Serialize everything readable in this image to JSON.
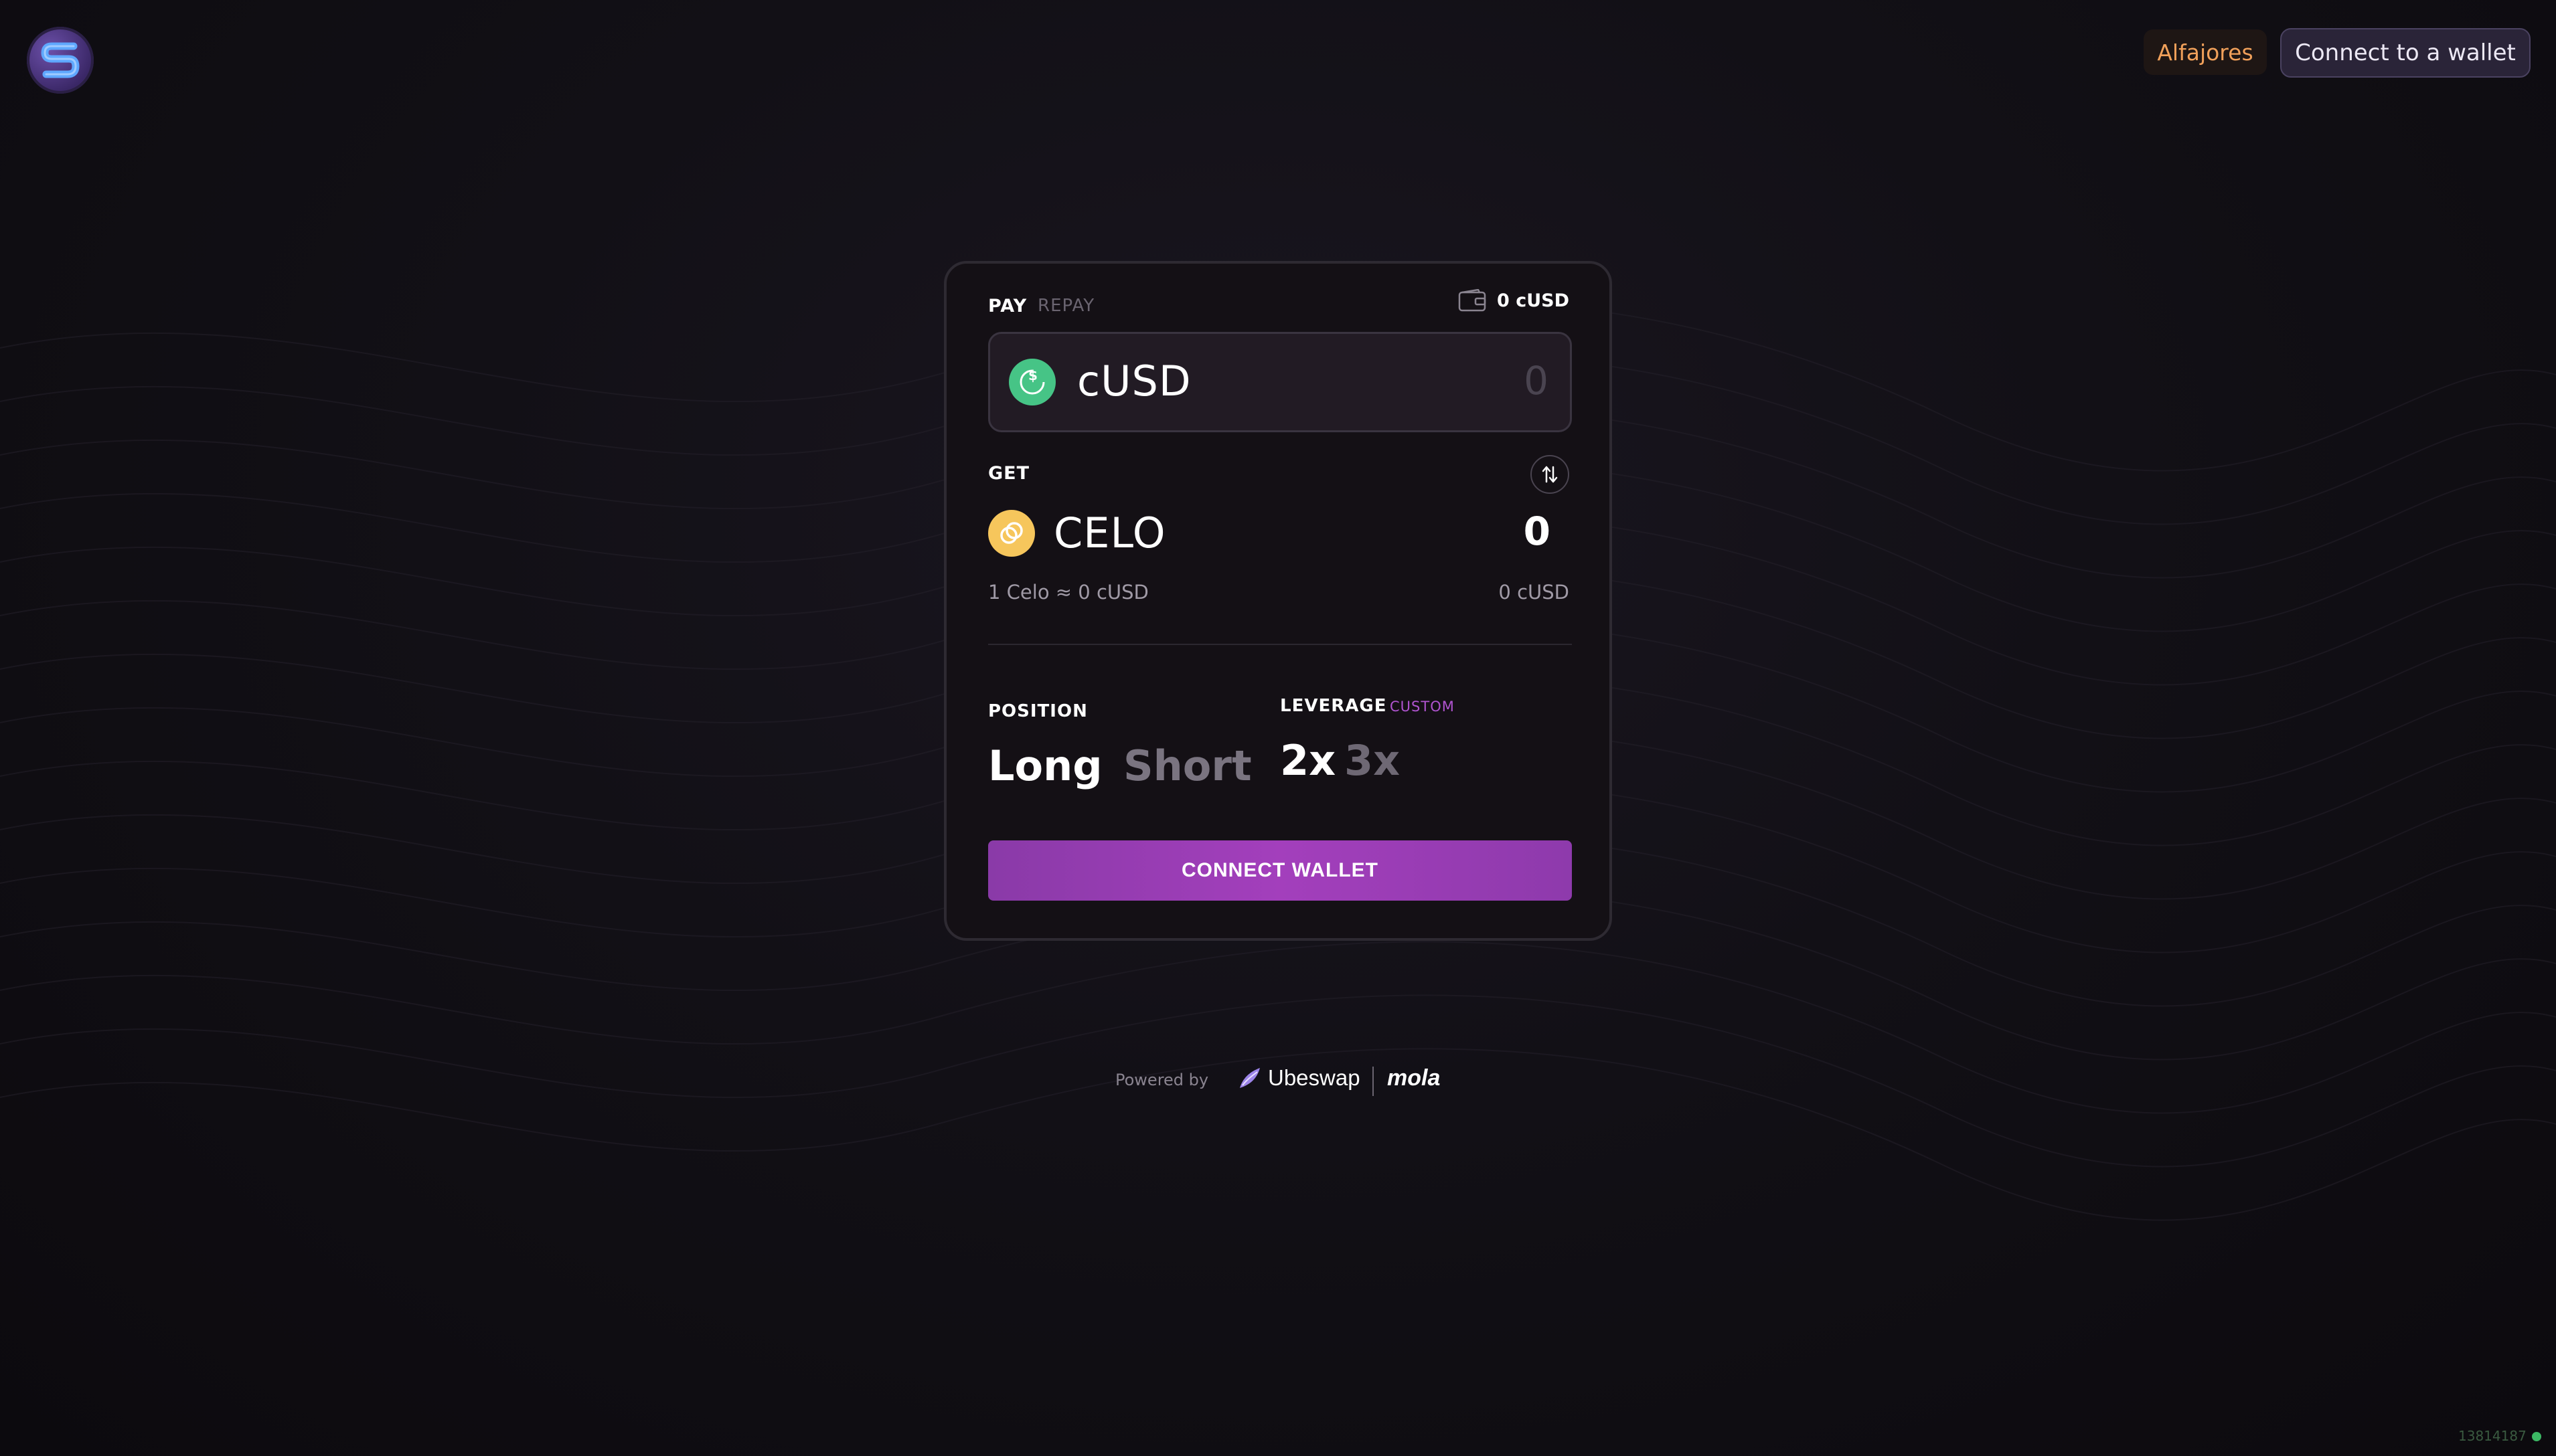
{
  "header": {
    "logo_icon": "synthetic-s-logo-icon",
    "network_label": "Alfajores",
    "connect_label": "Connect to a wallet"
  },
  "card": {
    "tabs": {
      "pay": "PAY",
      "repay": "REPAY"
    },
    "balance": {
      "icon": "wallet-icon",
      "text": "0 cUSD"
    },
    "pay": {
      "token": "cUSD",
      "token_icon": "cusd-token-icon",
      "amount_placeholder": "0"
    },
    "get": {
      "label": "GET",
      "token": "CELO",
      "token_icon": "celo-token-icon",
      "amount": "0",
      "swap_icon": "swap-arrows-icon"
    },
    "rate_text": "1 Celo ≈ 0 cUSD",
    "get_value_usd": "0 cUSD",
    "position": {
      "label": "POSITION",
      "options": [
        "Long",
        "Short"
      ],
      "selected": "Long"
    },
    "leverage": {
      "label": "LEVERAGE",
      "custom_label": "CUSTOM",
      "options": [
        "2x",
        "3x"
      ],
      "selected": "2x"
    },
    "action_label": "CONNECT WALLET"
  },
  "footer": {
    "powered_by": "Powered by",
    "partners": [
      "Ubeswap",
      "mola"
    ],
    "block_number": "13814187"
  },
  "colors": {
    "accent": "#9b3db8",
    "network": "#f0a05a",
    "cusd": "#46c486",
    "celo": "#f6c65c",
    "status": "#3cb864"
  }
}
